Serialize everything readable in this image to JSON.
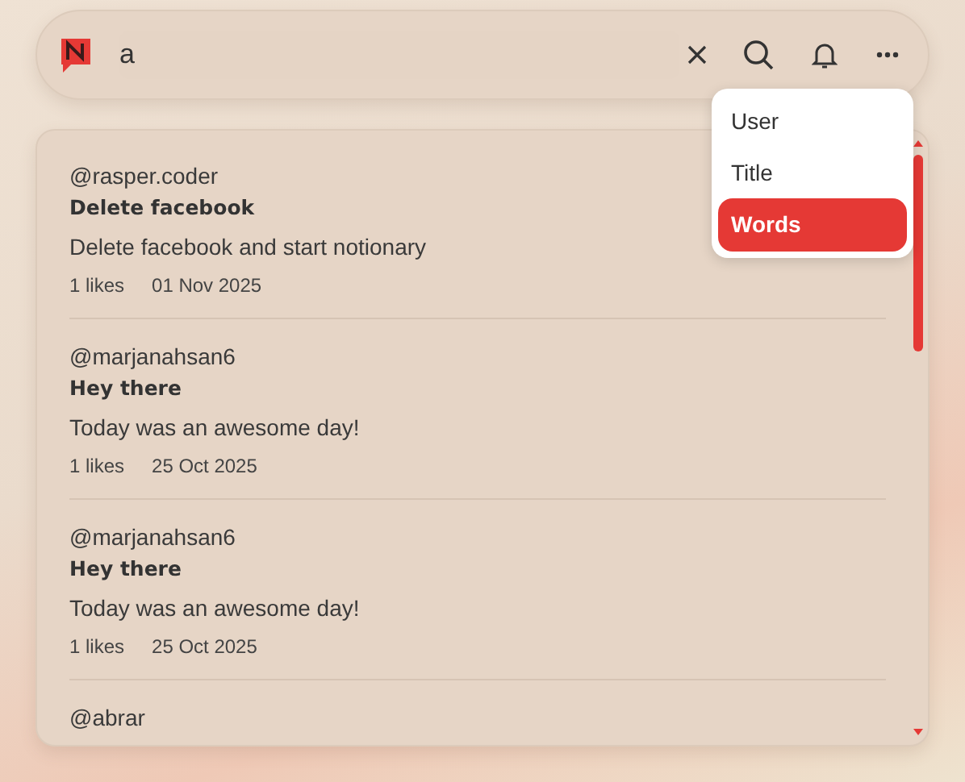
{
  "search": {
    "value": "a"
  },
  "filter_menu": [
    {
      "label": "User",
      "selected": false
    },
    {
      "label": "Title",
      "selected": false
    },
    {
      "label": "Words",
      "selected": true
    }
  ],
  "results": [
    {
      "user": "@rasper.coder",
      "title": "Delete facebook",
      "body": "Delete facebook and start notionary",
      "likes": "1 likes",
      "date": "01 Nov 2025"
    },
    {
      "user": "@marjanahsan6",
      "title": "Hey there",
      "body": "Today was an awesome day!",
      "likes": "1 likes",
      "date": "25 Oct 2025"
    },
    {
      "user": "@marjanahsan6",
      "title": "Hey there",
      "body": "Today was an awesome day!",
      "likes": "1 likes",
      "date": "25 Oct 2025"
    },
    {
      "user": "@abrar"
    }
  ]
}
